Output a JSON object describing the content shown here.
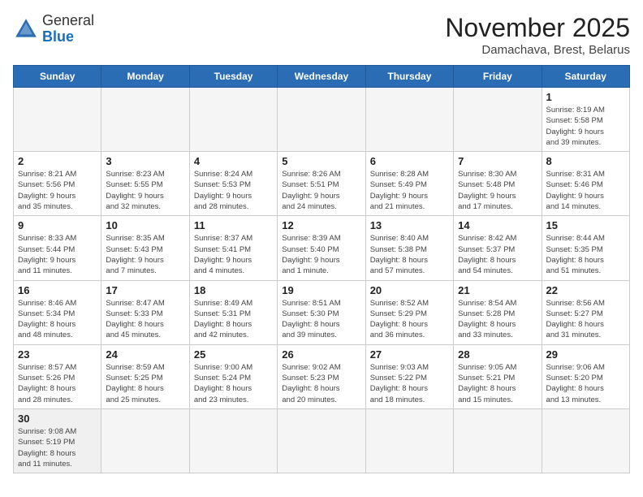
{
  "logo": {
    "general": "General",
    "blue": "Blue"
  },
  "title": "November 2025",
  "location": "Damachava, Brest, Belarus",
  "weekdays": [
    "Sunday",
    "Monday",
    "Tuesday",
    "Wednesday",
    "Thursday",
    "Friday",
    "Saturday"
  ],
  "days": [
    {
      "date": "",
      "info": ""
    },
    {
      "date": "",
      "info": ""
    },
    {
      "date": "",
      "info": ""
    },
    {
      "date": "",
      "info": ""
    },
    {
      "date": "",
      "info": ""
    },
    {
      "date": "",
      "info": ""
    },
    {
      "date": "1",
      "info": "Sunrise: 8:19 AM\nSunset: 5:58 PM\nDaylight: 9 hours\nand 39 minutes."
    },
    {
      "date": "2",
      "info": "Sunrise: 8:21 AM\nSunset: 5:56 PM\nDaylight: 9 hours\nand 35 minutes."
    },
    {
      "date": "3",
      "info": "Sunrise: 8:23 AM\nSunset: 5:55 PM\nDaylight: 9 hours\nand 32 minutes."
    },
    {
      "date": "4",
      "info": "Sunrise: 8:24 AM\nSunset: 5:53 PM\nDaylight: 9 hours\nand 28 minutes."
    },
    {
      "date": "5",
      "info": "Sunrise: 8:26 AM\nSunset: 5:51 PM\nDaylight: 9 hours\nand 24 minutes."
    },
    {
      "date": "6",
      "info": "Sunrise: 8:28 AM\nSunset: 5:49 PM\nDaylight: 9 hours\nand 21 minutes."
    },
    {
      "date": "7",
      "info": "Sunrise: 8:30 AM\nSunset: 5:48 PM\nDaylight: 9 hours\nand 17 minutes."
    },
    {
      "date": "8",
      "info": "Sunrise: 8:31 AM\nSunset: 5:46 PM\nDaylight: 9 hours\nand 14 minutes."
    },
    {
      "date": "9",
      "info": "Sunrise: 8:33 AM\nSunset: 5:44 PM\nDaylight: 9 hours\nand 11 minutes."
    },
    {
      "date": "10",
      "info": "Sunrise: 8:35 AM\nSunset: 5:43 PM\nDaylight: 9 hours\nand 7 minutes."
    },
    {
      "date": "11",
      "info": "Sunrise: 8:37 AM\nSunset: 5:41 PM\nDaylight: 9 hours\nand 4 minutes."
    },
    {
      "date": "12",
      "info": "Sunrise: 8:39 AM\nSunset: 5:40 PM\nDaylight: 9 hours\nand 1 minute."
    },
    {
      "date": "13",
      "info": "Sunrise: 8:40 AM\nSunset: 5:38 PM\nDaylight: 8 hours\nand 57 minutes."
    },
    {
      "date": "14",
      "info": "Sunrise: 8:42 AM\nSunset: 5:37 PM\nDaylight: 8 hours\nand 54 minutes."
    },
    {
      "date": "15",
      "info": "Sunrise: 8:44 AM\nSunset: 5:35 PM\nDaylight: 8 hours\nand 51 minutes."
    },
    {
      "date": "16",
      "info": "Sunrise: 8:46 AM\nSunset: 5:34 PM\nDaylight: 8 hours\nand 48 minutes."
    },
    {
      "date": "17",
      "info": "Sunrise: 8:47 AM\nSunset: 5:33 PM\nDaylight: 8 hours\nand 45 minutes."
    },
    {
      "date": "18",
      "info": "Sunrise: 8:49 AM\nSunset: 5:31 PM\nDaylight: 8 hours\nand 42 minutes."
    },
    {
      "date": "19",
      "info": "Sunrise: 8:51 AM\nSunset: 5:30 PM\nDaylight: 8 hours\nand 39 minutes."
    },
    {
      "date": "20",
      "info": "Sunrise: 8:52 AM\nSunset: 5:29 PM\nDaylight: 8 hours\nand 36 minutes."
    },
    {
      "date": "21",
      "info": "Sunrise: 8:54 AM\nSunset: 5:28 PM\nDaylight: 8 hours\nand 33 minutes."
    },
    {
      "date": "22",
      "info": "Sunrise: 8:56 AM\nSunset: 5:27 PM\nDaylight: 8 hours\nand 31 minutes."
    },
    {
      "date": "23",
      "info": "Sunrise: 8:57 AM\nSunset: 5:26 PM\nDaylight: 8 hours\nand 28 minutes."
    },
    {
      "date": "24",
      "info": "Sunrise: 8:59 AM\nSunset: 5:25 PM\nDaylight: 8 hours\nand 25 minutes."
    },
    {
      "date": "25",
      "info": "Sunrise: 9:00 AM\nSunset: 5:24 PM\nDaylight: 8 hours\nand 23 minutes."
    },
    {
      "date": "26",
      "info": "Sunrise: 9:02 AM\nSunset: 5:23 PM\nDaylight: 8 hours\nand 20 minutes."
    },
    {
      "date": "27",
      "info": "Sunrise: 9:03 AM\nSunset: 5:22 PM\nDaylight: 8 hours\nand 18 minutes."
    },
    {
      "date": "28",
      "info": "Sunrise: 9:05 AM\nSunset: 5:21 PM\nDaylight: 8 hours\nand 15 minutes."
    },
    {
      "date": "29",
      "info": "Sunrise: 9:06 AM\nSunset: 5:20 PM\nDaylight: 8 hours\nand 13 minutes."
    },
    {
      "date": "30",
      "info": "Sunrise: 9:08 AM\nSunset: 5:19 PM\nDaylight: 8 hours\nand 11 minutes."
    },
    {
      "date": "",
      "info": ""
    },
    {
      "date": "",
      "info": ""
    },
    {
      "date": "",
      "info": ""
    },
    {
      "date": "",
      "info": ""
    },
    {
      "date": "",
      "info": ""
    },
    {
      "date": "",
      "info": ""
    }
  ]
}
